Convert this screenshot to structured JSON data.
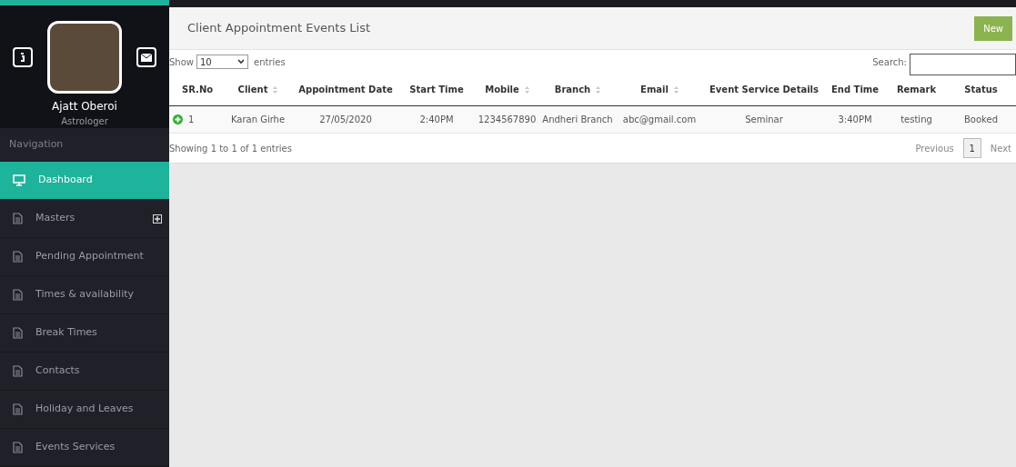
{
  "profile": {
    "name": "Ajatt Oberoi",
    "role": "Astrologer"
  },
  "navigation": {
    "heading": "Navigation",
    "items": [
      {
        "label": "Dashboard",
        "kind": "monitor",
        "selected": true
      },
      {
        "label": "Masters",
        "kind": "page",
        "selected": false,
        "expandable": true
      },
      {
        "label": "Pending Appointment",
        "kind": "page",
        "selected": false
      },
      {
        "label": "Times & availability",
        "kind": "page",
        "selected": false
      },
      {
        "label": "Break Times",
        "kind": "page",
        "selected": false
      },
      {
        "label": "Contacts",
        "kind": "page",
        "selected": false
      },
      {
        "label": "Holiday and Leaves",
        "kind": "page",
        "selected": false
      },
      {
        "label": "Events Services",
        "kind": "page",
        "selected": false
      }
    ]
  },
  "page": {
    "title": "Client Appointment Events List",
    "new_button": "New"
  },
  "table": {
    "show_label": "Show",
    "page_size": "10",
    "entries_label": "entries",
    "search_label": "Search:",
    "columns": [
      {
        "label": "SR.No",
        "sort_icon": false
      },
      {
        "label": "Client",
        "sort_icon": true
      },
      {
        "label": "Appointment Date",
        "sort_icon": false
      },
      {
        "label": "Start Time",
        "sort_icon": false
      },
      {
        "label": "Mobile",
        "sort_icon": true
      },
      {
        "label": "Branch",
        "sort_icon": true
      },
      {
        "label": "Email",
        "sort_icon": true
      },
      {
        "label": "Event Service Details",
        "sort_icon": false
      },
      {
        "label": "End Time",
        "sort_icon": false
      },
      {
        "label": "Remark",
        "sort_icon": false
      },
      {
        "label": "Status",
        "sort_icon": false
      }
    ],
    "rows": [
      [
        "1",
        "Karan Girhe",
        "27/05/2020",
        "2:40PM",
        "1234567890",
        "Andheri Branch",
        "abc@gmail.com",
        "Seminar",
        "3:40PM",
        "testing",
        "Booked"
      ]
    ],
    "info": "Showing 1 to 1 of 1 entries",
    "pagination": {
      "previous": "Previous",
      "pages": [
        {
          "label": "1",
          "selected": true
        }
      ],
      "next": "Next"
    }
  }
}
